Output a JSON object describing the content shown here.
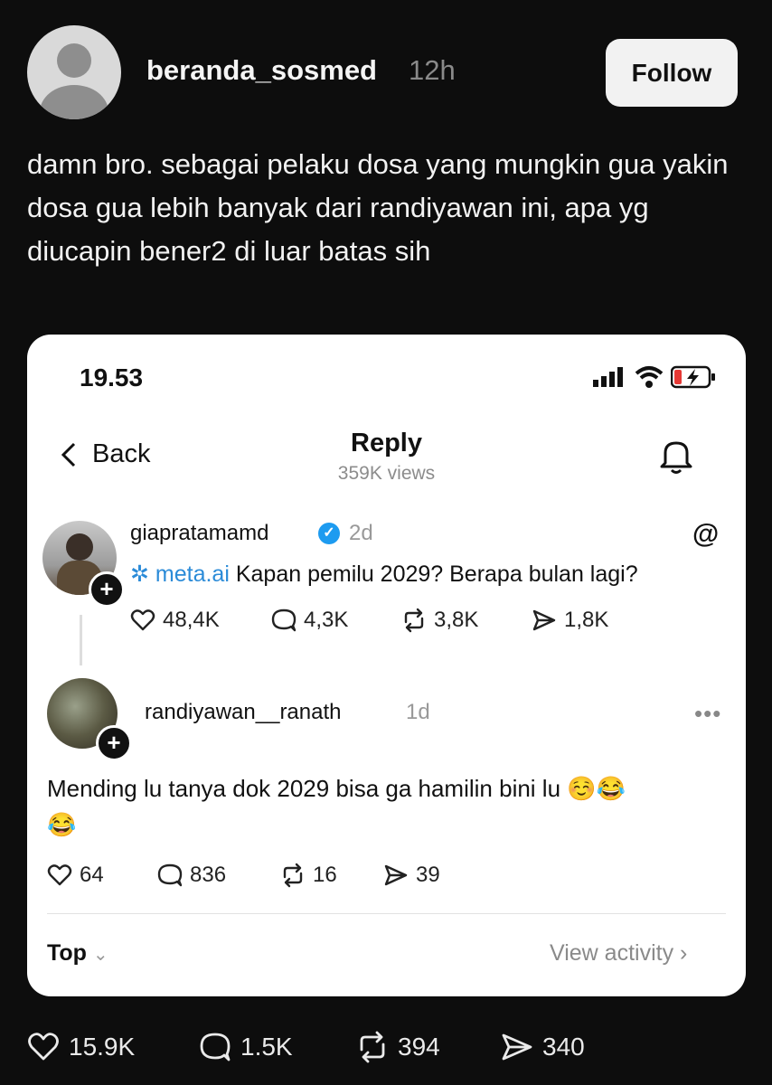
{
  "post": {
    "username": "beranda_sosmed",
    "time": "12h",
    "follow_label": "Follow",
    "text": "damn bro. sebagai pelaku dosa yang mungkin gua yakin dosa gua lebih banyak dari randiyawan ini, apa yg diucapin bener2 di luar batas sih",
    "likes": "15.9K",
    "replies": "1.5K",
    "reposts": "394",
    "shares": "340"
  },
  "screenshot": {
    "clock": "19.53",
    "back_label": "Back",
    "title": "Reply",
    "views": "359K views",
    "original": {
      "username": "giapratamamd",
      "time": "2d",
      "mention": "meta.ai",
      "text": " Kapan pemilu 2029? Berapa bulan lagi?",
      "likes": "48,4K",
      "replies": "4,3K",
      "reposts": "3,8K",
      "shares": "1,8K"
    },
    "reply": {
      "username": "randiyawan__ranath",
      "time": "1d",
      "text": "Mending lu tanya dok 2029 bisa ga hamilin bini lu",
      "emoji": "☺️😂",
      "emoji2": "😂",
      "likes": "64",
      "replies": "836",
      "reposts": "16",
      "shares": "39"
    },
    "sort_label": "Top",
    "view_activity": "View activity"
  }
}
